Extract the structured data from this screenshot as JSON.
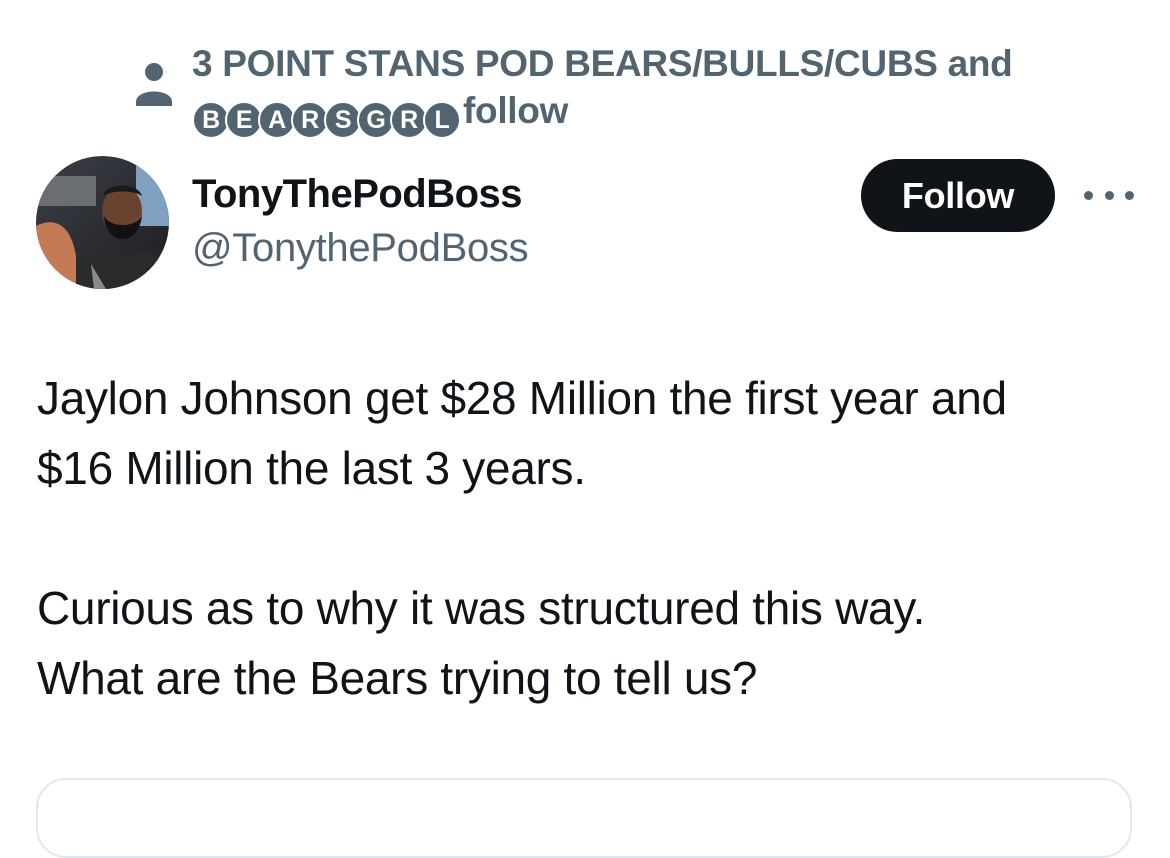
{
  "social_context": {
    "line1": "3 POINT STANS POD BEARS/BULLS/CUBS and",
    "circled_letters": [
      "B",
      "E",
      "A",
      "R",
      "S",
      "G",
      "R",
      "L"
    ],
    "line2_suffix": "follow",
    "icon": "person-icon"
  },
  "author": {
    "display_name": "TonyThePodBoss",
    "handle": "@TonythePodBoss",
    "avatar": "avatar"
  },
  "actions": {
    "follow_label": "Follow",
    "more_icon": "more-icon"
  },
  "tweet": {
    "line1": "Jaylon Johnson get $28 Million the first year and",
    "line2": "$16 Million the last 3 years.",
    "line3": "Curious as to why it was structured this way.",
    "line4": "What are the Bears trying to tell us?"
  },
  "colors": {
    "text_primary": "#0f1419",
    "text_secondary": "#536471",
    "follow_bg": "#0f1419",
    "background": "#ffffff"
  }
}
